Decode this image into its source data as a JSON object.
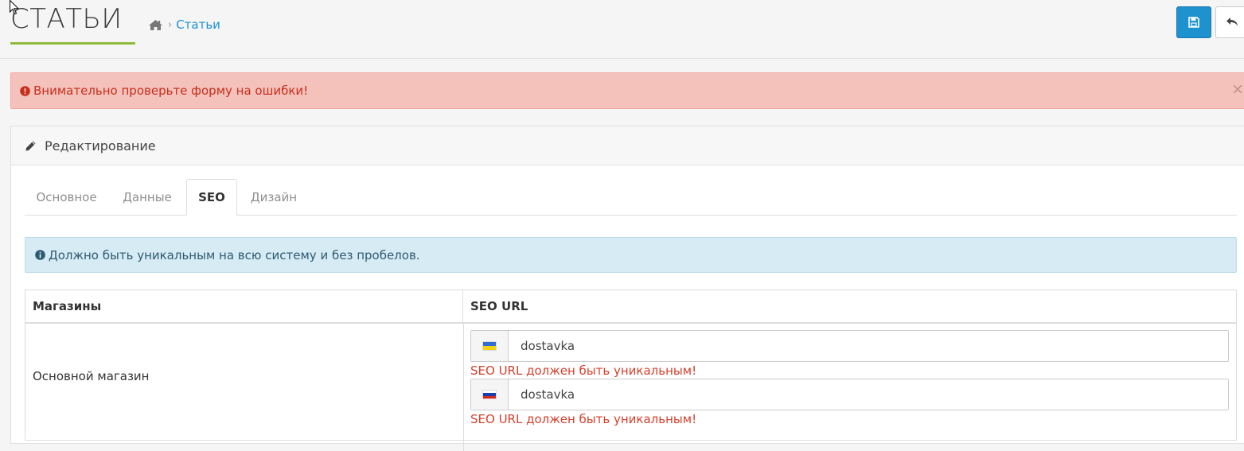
{
  "header": {
    "title": "СТАТЬИ",
    "breadcrumb": {
      "home_icon": "home-icon",
      "separator": "›",
      "current": "Статьи"
    },
    "buttons": {
      "save_icon": "save-icon",
      "back_icon": "reply-icon"
    }
  },
  "alert_error": {
    "icon": "exclamation-circle-icon",
    "message": "Внимательно проверьте форму на ошибки!",
    "close": "×"
  },
  "panel": {
    "icon": "pencil-icon",
    "title": "Редактирование",
    "tabs": [
      {
        "label": "Основное",
        "active": false
      },
      {
        "label": "Данные",
        "active": false
      },
      {
        "label": "SEO",
        "active": true
      },
      {
        "label": "Дизайн",
        "active": false
      }
    ],
    "info": {
      "icon": "info-circle-icon",
      "message": "Должно быть уникальным на всю систему и без пробелов."
    },
    "table": {
      "headers": [
        "Магазины",
        "SEO URL"
      ],
      "rows": [
        {
          "store": "Основной магазин",
          "fields": [
            {
              "flag": "ua-flag-icon",
              "value": "dostavka",
              "error": "SEO URL должен быть уникальным!"
            },
            {
              "flag": "ru-flag-icon",
              "value": "dostavka",
              "error": "SEO URL должен быть уникальным!"
            }
          ]
        }
      ]
    }
  },
  "colors": {
    "accent": "#1e91cf",
    "title_underline": "#8fbb3a",
    "error": "#c72f1d",
    "error_bg": "#f5c1bb",
    "info_bg": "#d7ebf4"
  }
}
